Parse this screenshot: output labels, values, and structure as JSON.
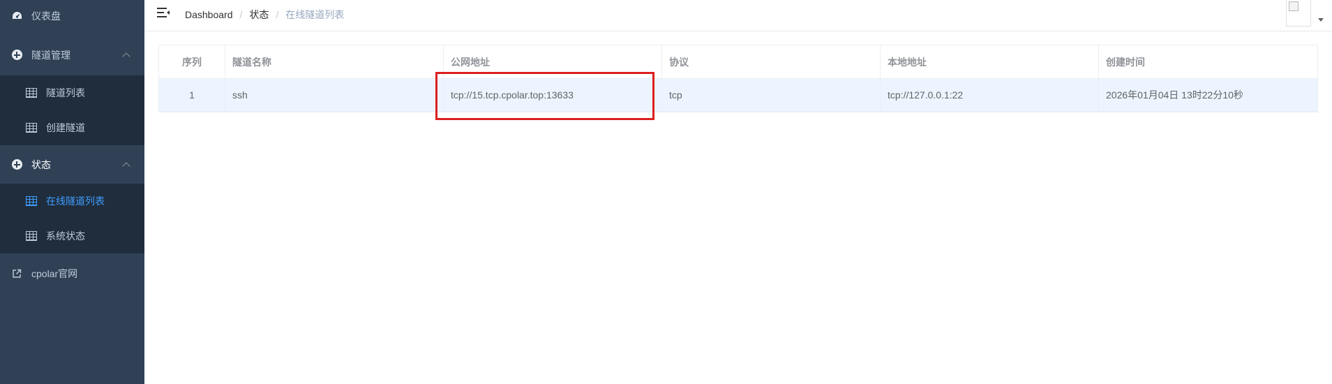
{
  "sidebar": {
    "items": [
      {
        "label": "仪表盘",
        "icon": "dashboard-icon"
      },
      {
        "label": "隧道管理",
        "icon": "circle-plus-icon",
        "expandable": true
      },
      {
        "label": "隧道列表",
        "icon": "grid-icon"
      },
      {
        "label": "创建隧道",
        "icon": "grid-icon"
      },
      {
        "label": "状态",
        "icon": "circle-plus-icon",
        "expandable": true
      },
      {
        "label": "在线隧道列表",
        "icon": "grid-icon",
        "active": true
      },
      {
        "label": "系统状态",
        "icon": "grid-icon"
      },
      {
        "label": "cpolar官网",
        "icon": "external-link-icon"
      }
    ],
    "active_color": "#409eff",
    "background": "#304156"
  },
  "header": {
    "breadcrumb": [
      "Dashboard",
      "状态",
      "在线隧道列表"
    ],
    "separator": "/"
  },
  "table": {
    "columns": [
      "序列",
      "隧道名称",
      "公网地址",
      "协议",
      "本地地址",
      "创建时间"
    ],
    "rows": [
      [
        "1",
        "ssh",
        "tcp://15.tcp.cpolar.top:13633",
        "tcp",
        "tcp://127.0.0.1:22",
        "2026年01月04日 13时22分10秒"
      ]
    ]
  },
  "annotation": {
    "color": "#dd1f1f",
    "target": "公网地址"
  }
}
